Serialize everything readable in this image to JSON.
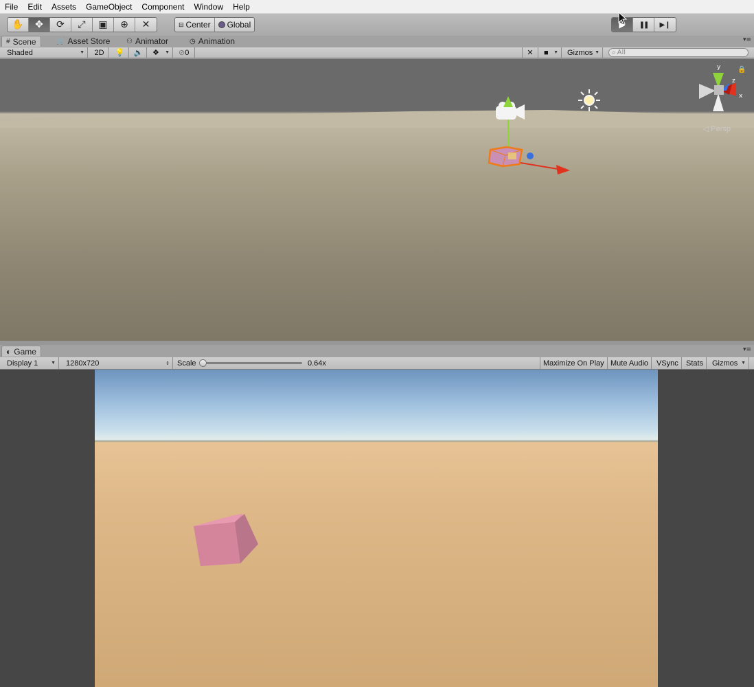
{
  "menu": [
    "File",
    "Edit",
    "Assets",
    "GameObject",
    "Component",
    "Window",
    "Help"
  ],
  "toolbar": {
    "tools": [
      {
        "name": "hand-tool",
        "icon": "hand-icon",
        "glyph": "✋",
        "active": false
      },
      {
        "name": "move-tool",
        "icon": "move-icon",
        "glyph": "✥",
        "active": true
      },
      {
        "name": "rotate-tool",
        "icon": "rotate-icon",
        "glyph": "⟳",
        "active": false
      },
      {
        "name": "scale-tool",
        "icon": "scale-icon",
        "glyph": "⤢",
        "active": false
      },
      {
        "name": "rect-tool",
        "icon": "rect-icon",
        "glyph": "▣",
        "active": false
      },
      {
        "name": "transform-tool",
        "icon": "transform-icon",
        "glyph": "⊕",
        "active": false
      },
      {
        "name": "custom-tool",
        "icon": "custom-tool-icon",
        "glyph": "✕",
        "active": false
      }
    ],
    "pivot_label": "Center",
    "space_label": "Global",
    "play_icon": "▶",
    "pause_icon": "❚❚",
    "step_icon": "▶❙"
  },
  "scene_tabs": [
    {
      "label": "Scene",
      "icon": "#",
      "active": true
    },
    {
      "label": "Asset Store",
      "icon": "🛒",
      "active": false
    },
    {
      "label": "Animator",
      "icon": "⚇",
      "active": false
    },
    {
      "label": "Animation",
      "icon": "◷",
      "active": false
    }
  ],
  "scene_bar": {
    "draw_mode": "Shaded",
    "mode_2d": "2D",
    "effects_count": "0",
    "gizmos": "Gizmos",
    "search_placeholder": "All"
  },
  "scene_view": {
    "persp_label": "◁ Persp",
    "axis_x": "x",
    "axis_y": "y",
    "axis_z": "z"
  },
  "game_tab": {
    "label": "Game",
    "icon": "◐"
  },
  "game_bar": {
    "display": "Display 1",
    "resolution": "1280x720",
    "scale_label": "Scale",
    "scale_value": "0.64x",
    "maximize": "Maximize On Play",
    "mute": "Mute Audio",
    "vsync": "VSync",
    "stats": "Stats",
    "gizmos": "Gizmos"
  },
  "colors": {
    "axis_x": "#e0321e",
    "axis_y": "#8fd43a",
    "axis_z": "#3a6fe0",
    "selection": "#f07a18",
    "cube": "#d98ba1"
  }
}
